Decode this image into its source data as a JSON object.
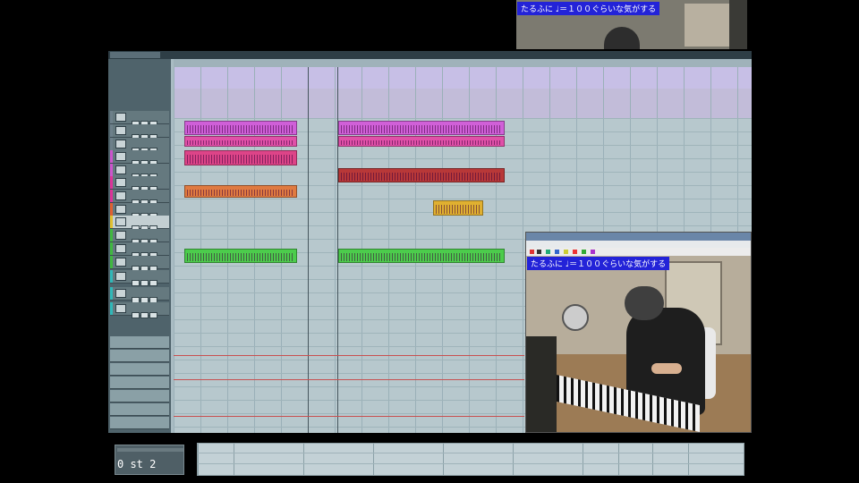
{
  "webcam_top": {
    "caption": "たるふに ♩＝１００ぐらいな気がする"
  },
  "daw": {
    "header_tabs": [
      "",
      ""
    ],
    "tracks": [
      {
        "name": "",
        "color": "#6d808a"
      },
      {
        "name": "",
        "color": "#6d808a"
      },
      {
        "name": "",
        "color": "#6d808a"
      },
      {
        "name": "",
        "color": "#cc55cc"
      },
      {
        "name": "",
        "color": "#cc55cc"
      },
      {
        "name": "",
        "color": "#dd3399"
      },
      {
        "name": "",
        "color": "#dd3399"
      },
      {
        "name": "",
        "color": "#e06030"
      },
      {
        "name": "",
        "color": "#e0c030",
        "selected": true
      },
      {
        "name": "",
        "color": "#40b840"
      },
      {
        "name": "",
        "color": "#40b840"
      },
      {
        "name": "",
        "color": "#40b840"
      },
      {
        "name": "",
        "color": "#30b8b8"
      },
      {
        "name": "",
        "color": "#30b8b8"
      },
      {
        "name": "",
        "color": "#30b8b8"
      }
    ],
    "regions": [
      {
        "label": "",
        "color": "#cf5fd8"
      },
      {
        "label": "",
        "color": "#d060d8"
      },
      {
        "label": "",
        "color": "#e050a8"
      },
      {
        "label": "",
        "color": "#e050a8"
      },
      {
        "label": "",
        "color": "#dd4488"
      },
      {
        "label": "",
        "color": "#b83838"
      },
      {
        "label": "",
        "color": "#e07a40"
      },
      {
        "label": "",
        "color": "#e0b030"
      },
      {
        "label": "",
        "color": "#4ccc4c"
      },
      {
        "label": "",
        "color": "#4ccc4c"
      }
    ]
  },
  "video_window": {
    "title": "",
    "menu": "",
    "caption": "たるふに ♩＝１００ぐらいな気がする"
  },
  "transport": {
    "counter": "0  st 2"
  }
}
